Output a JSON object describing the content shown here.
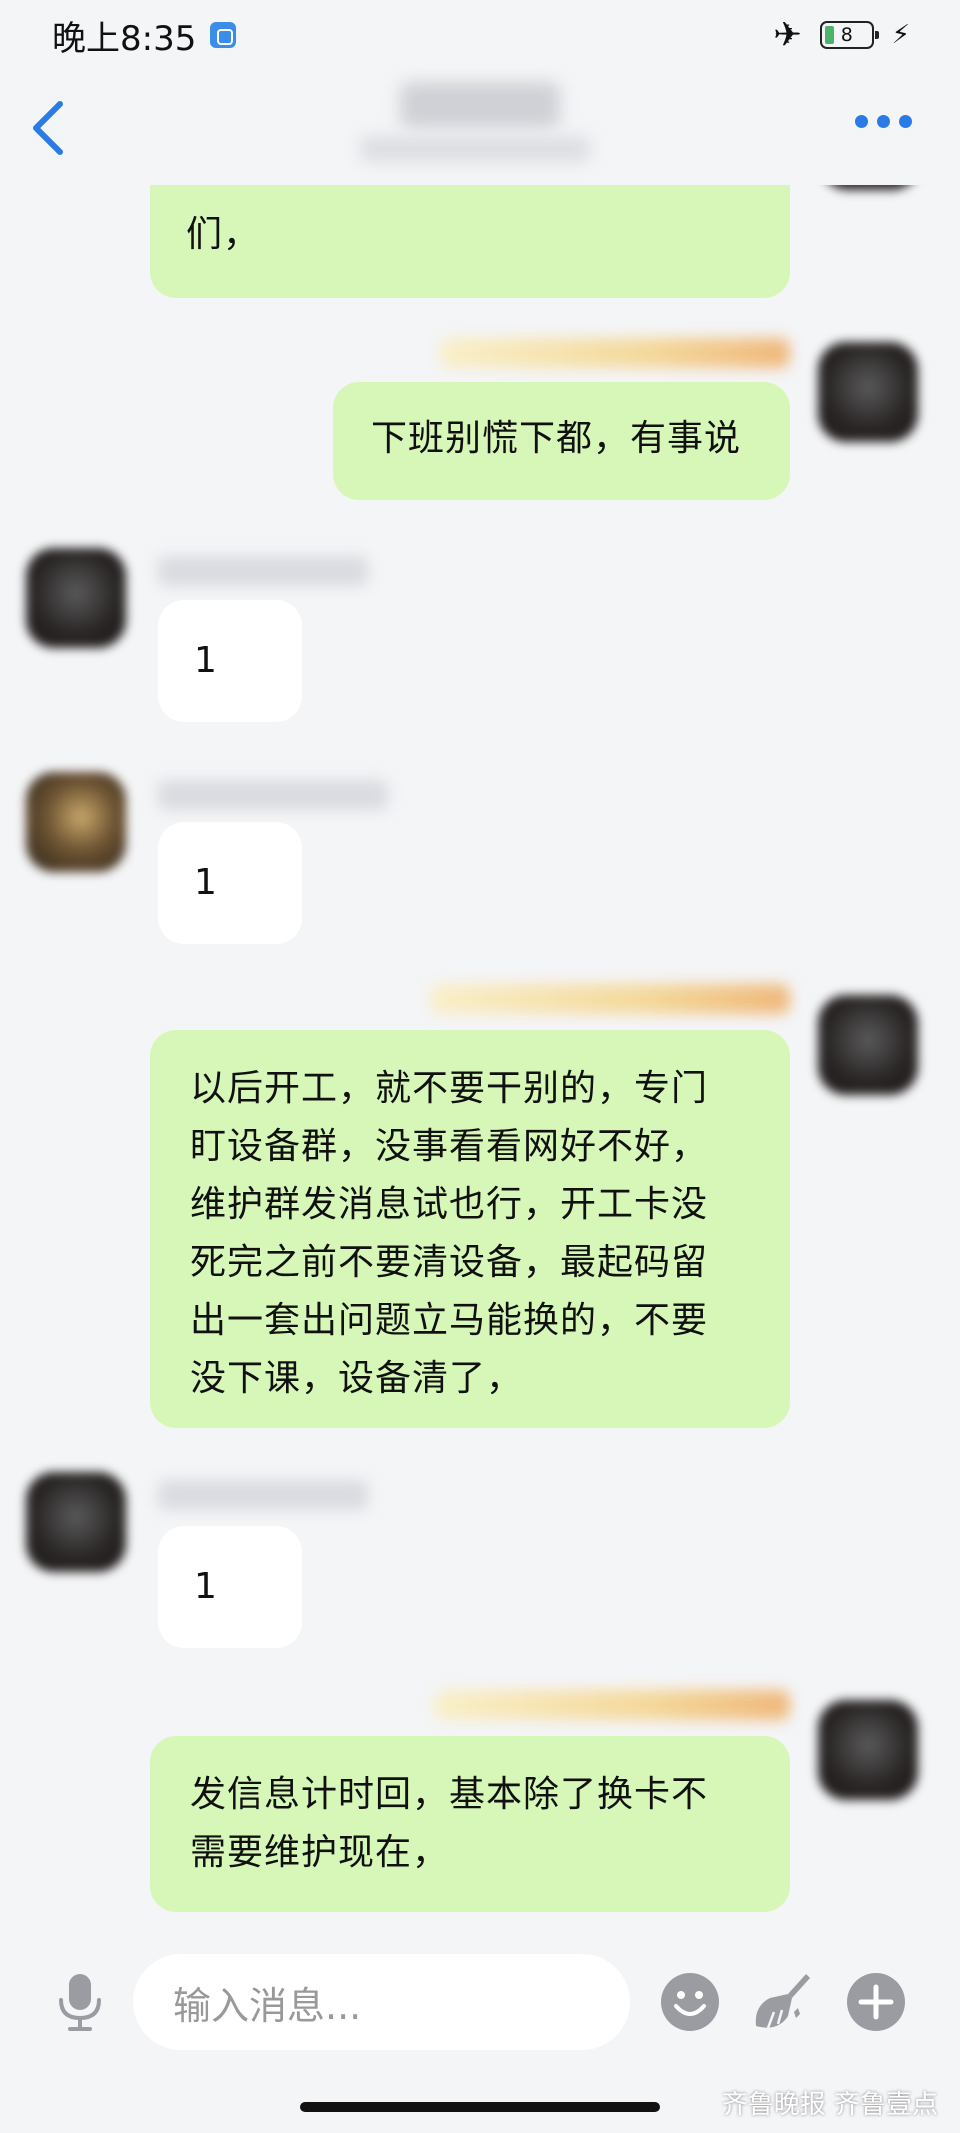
{
  "status_bar": {
    "time": "晚上8:35",
    "battery": "8"
  },
  "messages": [
    {
      "side": "right",
      "text": "们，"
    },
    {
      "side": "right",
      "text": "下班别慌下都，有事说"
    },
    {
      "side": "left",
      "text": "1"
    },
    {
      "side": "left",
      "text": "1"
    },
    {
      "side": "right",
      "text": "以后开工，就不要干别的，专门\n盯设备群，没事看看网好不好，\n维护群发消息试也行，开工卡没\n死完之前不要清设备，最起码留\n出一套出问题立马能换的，不要\n没下课，设备清了，"
    },
    {
      "side": "left",
      "text": "1"
    },
    {
      "side": "right",
      "text": "发信息计时回，基本除了换卡不\n需要维护现在，"
    }
  ],
  "input": {
    "placeholder": "输入消息..."
  },
  "watermark": "齐鲁晚报  齐鲁壹点",
  "colors": {
    "accent": "#2a7be5",
    "self_bubble": "#d7f7b8",
    "other_bubble": "#ffffff",
    "background": "#f4f5f7"
  },
  "icons": [
    "back-icon",
    "more-icon",
    "mic-icon",
    "emoji-icon",
    "brush-icon",
    "plus-icon",
    "airplane-icon",
    "battery-icon",
    "charging-icon"
  ]
}
